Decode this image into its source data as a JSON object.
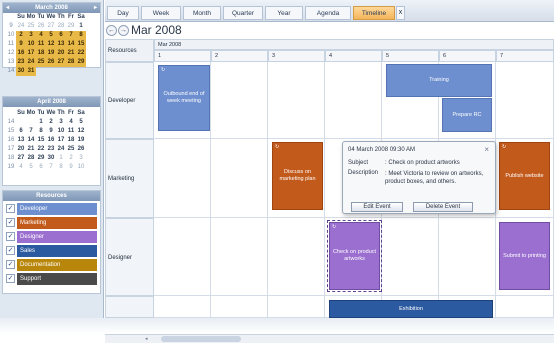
{
  "mini_calendars": [
    {
      "title": "March 2008",
      "weekday_headers": [
        "Su",
        "Mo",
        "Tu",
        "We",
        "Th",
        "Fr",
        "Sa"
      ],
      "weeks": [
        {
          "wk": "9",
          "days": [
            "24",
            "25",
            "26",
            "27",
            "28",
            "29",
            "1"
          ]
        },
        {
          "wk": "10",
          "days": [
            "2",
            "3",
            "4",
            "5",
            "6",
            "7",
            "8"
          ]
        },
        {
          "wk": "11",
          "days": [
            "9",
            "10",
            "11",
            "12",
            "13",
            "14",
            "15"
          ]
        },
        {
          "wk": "12",
          "days": [
            "16",
            "17",
            "18",
            "19",
            "20",
            "21",
            "22"
          ]
        },
        {
          "wk": "13",
          "days": [
            "23",
            "24",
            "25",
            "26",
            "27",
            "28",
            "29"
          ]
        },
        {
          "wk": "14",
          "days": [
            "30",
            "31",
            "",
            "",
            "",
            "",
            ""
          ]
        }
      ]
    },
    {
      "title": "April 2008",
      "weekday_headers": [
        "Su",
        "Mo",
        "Tu",
        "We",
        "Th",
        "Fr",
        "Sa"
      ],
      "weeks": [
        {
          "wk": "14",
          "days": [
            "",
            "",
            "1",
            "2",
            "3",
            "4",
            "5"
          ]
        },
        {
          "wk": "15",
          "days": [
            "6",
            "7",
            "8",
            "9",
            "10",
            "11",
            "12"
          ]
        },
        {
          "wk": "16",
          "days": [
            "13",
            "14",
            "15",
            "16",
            "17",
            "18",
            "19"
          ]
        },
        {
          "wk": "17",
          "days": [
            "20",
            "21",
            "22",
            "23",
            "24",
            "25",
            "26"
          ]
        },
        {
          "wk": "18",
          "days": [
            "27",
            "28",
            "29",
            "30",
            "1",
            "2",
            "3"
          ]
        },
        {
          "wk": "19",
          "days": [
            "4",
            "5",
            "6",
            "7",
            "8",
            "9",
            "10"
          ]
        }
      ]
    }
  ],
  "resources_panel": {
    "title": "Resources",
    "items": [
      {
        "label": "Developer",
        "color": "#6e8fcf"
      },
      {
        "label": "Marketing",
        "color": "#c25a1c"
      },
      {
        "label": "Designer",
        "color": "#9b6fd0"
      },
      {
        "label": "Sales",
        "color": "#2c5aa0"
      },
      {
        "label": "Documentation",
        "color": "#b8860b"
      },
      {
        "label": "Support",
        "color": "#4a4a4a"
      }
    ]
  },
  "tabs": [
    {
      "label": "Day"
    },
    {
      "label": "Week"
    },
    {
      "label": "Month"
    },
    {
      "label": "Quarter"
    },
    {
      "label": "Year"
    },
    {
      "label": "Agenda"
    },
    {
      "label": "Timeline",
      "active": true
    }
  ],
  "tab_close_glyph": "x",
  "nav": {
    "title": "Mar 2008",
    "prev": "←",
    "next": "→"
  },
  "scheduler": {
    "resources_header": "Resources",
    "month_label": "Mar 2008",
    "days": [
      "1",
      "2",
      "3",
      "4",
      "5",
      "6",
      "7"
    ],
    "rows": [
      {
        "label": "Developer"
      },
      {
        "label": "Marketing"
      },
      {
        "label": "Designer"
      },
      {
        "label": ""
      }
    ],
    "events": {
      "outbound": "Outbound end of week meeting",
      "training": "Training",
      "prepare_rc": "Prepare RC",
      "discuss": "Discuss on marketing plan",
      "publish": "Publish website",
      "check": "Check on product artworks",
      "submit": "Submit to printing",
      "exhibition": "Exhibition"
    }
  },
  "popup": {
    "datetime": "04 March 2008 09:30 AM",
    "subject_label": "Subject",
    "subject_value": ": Check on product artworks",
    "description_label": "Description",
    "description_value": ": Meet Victoria to review on artworks, product boxes, and others.",
    "edit_button": "Edit Event",
    "delete_button": "Delete Event",
    "close_glyph": "×"
  },
  "colors": {
    "developer": "#6e8fcf",
    "marketing": "#c25a1c",
    "designer": "#9b6fd0",
    "sales": "#2c5aa0",
    "timeline_tab": "#f5b45b",
    "highlight_day": "#e9b948"
  }
}
